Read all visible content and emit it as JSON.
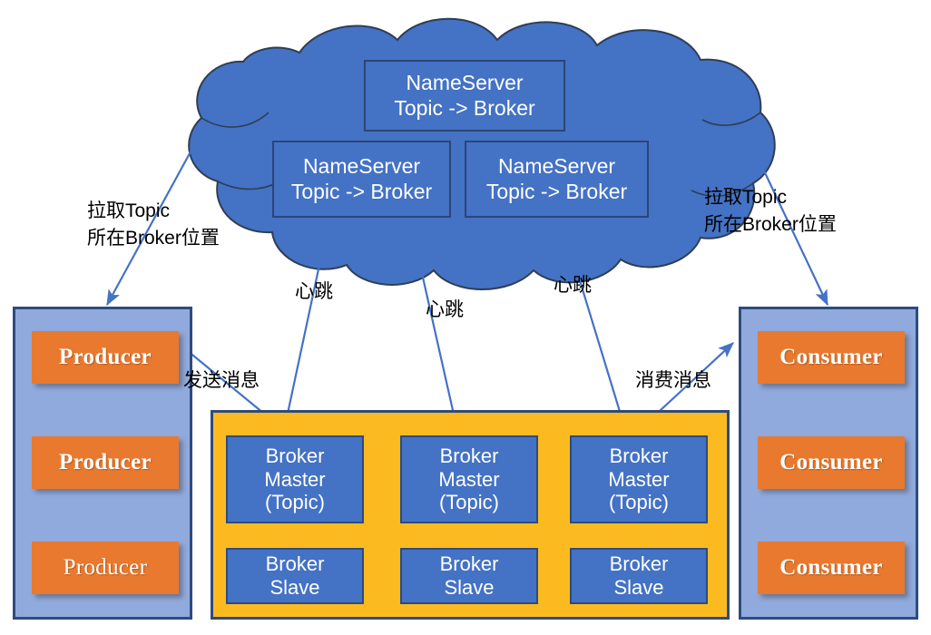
{
  "diagram": {
    "title": "RocketMQ Architecture",
    "colors": {
      "cloud_fill": "#4472C4",
      "cloud_stroke": "#2F3E54",
      "box_blue": "#4472C4",
      "box_blue_border": "#2E4B7C",
      "panel_blue": "#91AADD",
      "panel_border": "#2E4B7C",
      "endpoint_orange": "#E8792F",
      "cluster_yellow": "#FCBA21",
      "arrow_blue": "#4472C4",
      "text_white": "#FFFFFF",
      "text_black": "#000000"
    }
  },
  "cloud": {
    "name": "nameserver-cloud",
    "nameservers": [
      {
        "line1": "NameServer",
        "line2": "Topic -> Broker"
      },
      {
        "line1": "NameServer",
        "line2": "Topic -> Broker"
      },
      {
        "line1": "NameServer",
        "line2": "Topic -> Broker"
      }
    ]
  },
  "producer_panel": {
    "name": "producer-group",
    "items": [
      {
        "label": "Producer"
      },
      {
        "label": "Producer"
      },
      {
        "label": "Producer"
      }
    ]
  },
  "consumer_panel": {
    "name": "consumer-group",
    "items": [
      {
        "label": "Consumer"
      },
      {
        "label": "Consumer"
      },
      {
        "label": "Consumer"
      }
    ]
  },
  "broker_cluster": {
    "name": "broker-cluster",
    "columns": [
      {
        "master": {
          "line1": "Broker",
          "line2": "Master",
          "line3": "(Topic)"
        },
        "slave": {
          "line1": "Broker",
          "line2": "Slave"
        }
      },
      {
        "master": {
          "line1": "Broker",
          "line2": "Master",
          "line3": "(Topic)"
        },
        "slave": {
          "line1": "Broker",
          "line2": "Slave"
        }
      },
      {
        "master": {
          "line1": "Broker",
          "line2": "Master",
          "line3": "(Topic)"
        },
        "slave": {
          "line1": "Broker",
          "line2": "Slave"
        }
      }
    ]
  },
  "annotations": {
    "pull_topic_left": "拉取Topic\n所在Broker位置",
    "pull_topic_right": "拉取Topic\n所在Broker位置",
    "heartbeat_1": "心跳",
    "heartbeat_2": "心跳",
    "heartbeat_3": "心跳",
    "send_message": "发送消息",
    "consume_message": "消费消息"
  }
}
